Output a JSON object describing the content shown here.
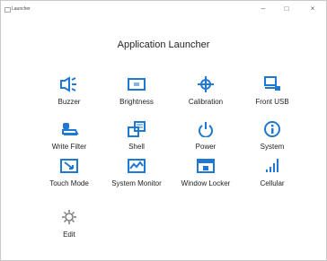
{
  "window": {
    "title": "Launcher",
    "minimize": "–",
    "maximize": "□",
    "close": "×"
  },
  "header": "Application Launcher",
  "accent": "#1f78d1",
  "tiles": [
    {
      "label": "Buzzer",
      "icon": "buzzer-icon"
    },
    {
      "label": "Brightness",
      "icon": "brightness-icon"
    },
    {
      "label": "Calibration",
      "icon": "calibration-icon"
    },
    {
      "label": "Front USB",
      "icon": "usb-icon"
    },
    {
      "label": "Write Filter",
      "icon": "write-filter-icon"
    },
    {
      "label": "Shell",
      "icon": "shell-icon"
    },
    {
      "label": "Power",
      "icon": "power-icon"
    },
    {
      "label": "System",
      "icon": "info-icon"
    },
    {
      "label": "Touch Mode",
      "icon": "touch-mode-icon"
    },
    {
      "label": "System Monitor",
      "icon": "monitor-icon"
    },
    {
      "label": "Window Locker",
      "icon": "window-lock-icon"
    },
    {
      "label": "Cellular",
      "icon": "cellular-icon"
    },
    {
      "label": "Edit",
      "icon": "gear-icon"
    }
  ]
}
